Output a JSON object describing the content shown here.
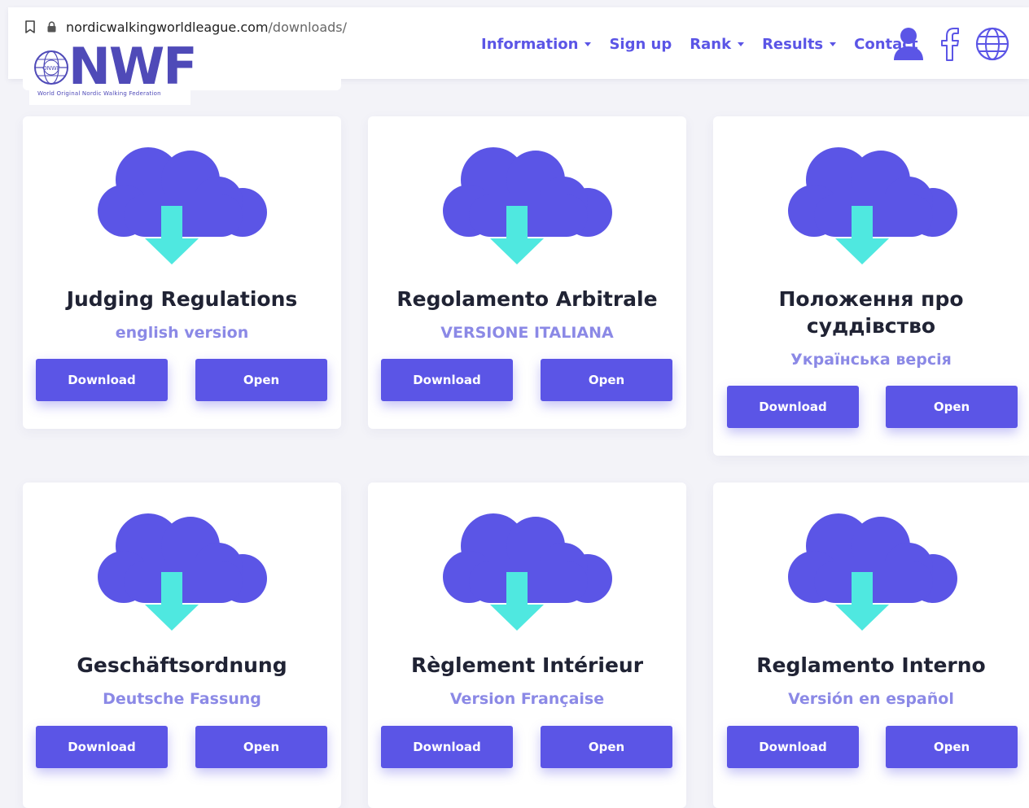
{
  "browser": {
    "url_domain": "nordicwalkingworldleague.com",
    "url_path": "/downloads/"
  },
  "logo": {
    "wordmark": "NWF",
    "tagline": "World Original Nordic Walking Federation",
    "globe_text": "ONWF"
  },
  "nav": {
    "items": [
      {
        "label": "Information",
        "dropdown": true
      },
      {
        "label": "Sign up",
        "dropdown": false
      },
      {
        "label": "Rank",
        "dropdown": true
      },
      {
        "label": "Results",
        "dropdown": true
      },
      {
        "label": "Contact",
        "dropdown": false
      }
    ],
    "icons": [
      "user-icon",
      "facebook-icon",
      "globe-icon"
    ]
  },
  "colors": {
    "accent": "#5b55e6",
    "cloud": "#5b55e6",
    "arrow": "#4fe8e0",
    "subtitle": "#8b89e6",
    "background": "#f3f3f8"
  },
  "cards": [
    {
      "title": "Judging Regulations",
      "subtitle": "english version",
      "download_label": "Download",
      "open_label": "Open"
    },
    {
      "title": "Regolamento Arbitrale",
      "subtitle": "VERSIONE ITALIANA",
      "download_label": "Download",
      "open_label": "Open"
    },
    {
      "title": "Положення про суддівство",
      "subtitle": "Українська версія",
      "download_label": "Download",
      "open_label": "Open"
    },
    {
      "title": "Geschäftsordnung",
      "subtitle": "Deutsche Fassung",
      "download_label": "Download",
      "open_label": "Open"
    },
    {
      "title": "Règlement Intérieur",
      "subtitle": "Version Française",
      "download_label": "Download",
      "open_label": "Open"
    },
    {
      "title": "Reglamento Interno",
      "subtitle": "Versión en español",
      "download_label": "Download",
      "open_label": "Open"
    }
  ]
}
